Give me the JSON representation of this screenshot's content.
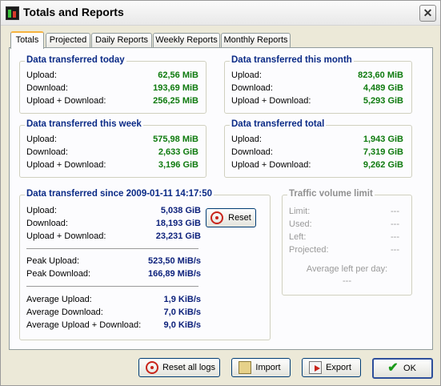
{
  "window": {
    "title": "Totals and Reports",
    "close_glyph": "✕"
  },
  "tabs": [
    {
      "label": "Totals",
      "active": true
    },
    {
      "label": "Projected"
    },
    {
      "label": "Daily Reports"
    },
    {
      "label": "Weekly Reports"
    },
    {
      "label": "Monthly Reports"
    }
  ],
  "today": {
    "title": "Data transferred today",
    "rows": [
      {
        "label": "Upload:",
        "value": "62,56 MiB"
      },
      {
        "label": "Download:",
        "value": "193,69 MiB"
      },
      {
        "label": "Upload + Download:",
        "value": "256,25 MiB"
      }
    ]
  },
  "month": {
    "title": "Data transferred this month",
    "rows": [
      {
        "label": "Upload:",
        "value": "823,60 MiB"
      },
      {
        "label": "Download:",
        "value": "4,489 GiB"
      },
      {
        "label": "Upload + Download:",
        "value": "5,293 GiB"
      }
    ]
  },
  "week": {
    "title": "Data transferred this week",
    "rows": [
      {
        "label": "Upload:",
        "value": "575,98 MiB"
      },
      {
        "label": "Download:",
        "value": "2,633 GiB"
      },
      {
        "label": "Upload + Download:",
        "value": "3,196 GiB"
      }
    ]
  },
  "total": {
    "title": "Data transferred total",
    "rows": [
      {
        "label": "Upload:",
        "value": "1,943 GiB"
      },
      {
        "label": "Download:",
        "value": "7,319 GiB"
      },
      {
        "label": "Upload + Download:",
        "value": "9,262 GiB"
      }
    ]
  },
  "since": {
    "title": "Data transferred since 2009-01-11 14:17:50",
    "rows": [
      {
        "label": "Upload:",
        "value": "5,038 GiB"
      },
      {
        "label": "Download:",
        "value": "18,193 GiB"
      },
      {
        "label": "Upload + Download:",
        "value": "23,231 GiB"
      }
    ],
    "peak": [
      {
        "label": "Peak Upload:",
        "value": "523,50 MiB/s"
      },
      {
        "label": "Peak Download:",
        "value": "166,89 MiB/s"
      }
    ],
    "average": [
      {
        "label": "Average Upload:",
        "value": "1,9 KiB/s"
      },
      {
        "label": "Average Download:",
        "value": "7,0 KiB/s"
      },
      {
        "label": "Average Upload + Download:",
        "value": "9,0 KiB/s"
      }
    ],
    "reset_label": "Reset"
  },
  "limit": {
    "title": "Traffic volume limit",
    "rows": [
      {
        "label": "Limit:",
        "value": "---"
      },
      {
        "label": "Used:",
        "value": "---"
      },
      {
        "label": "Left:",
        "value": "---"
      },
      {
        "label": "Projected:",
        "value": "---"
      }
    ],
    "avg_label": "Average left per day:",
    "avg_value": "---"
  },
  "buttons": {
    "reset_all": "Reset all logs",
    "import": "Import",
    "export": "Export",
    "ok": "OK"
  },
  "icons": {
    "app": "app-traffic-icon",
    "reset": "refresh-icon",
    "import": "import-icon",
    "export": "export-icon",
    "ok": "checkmark-icon"
  }
}
